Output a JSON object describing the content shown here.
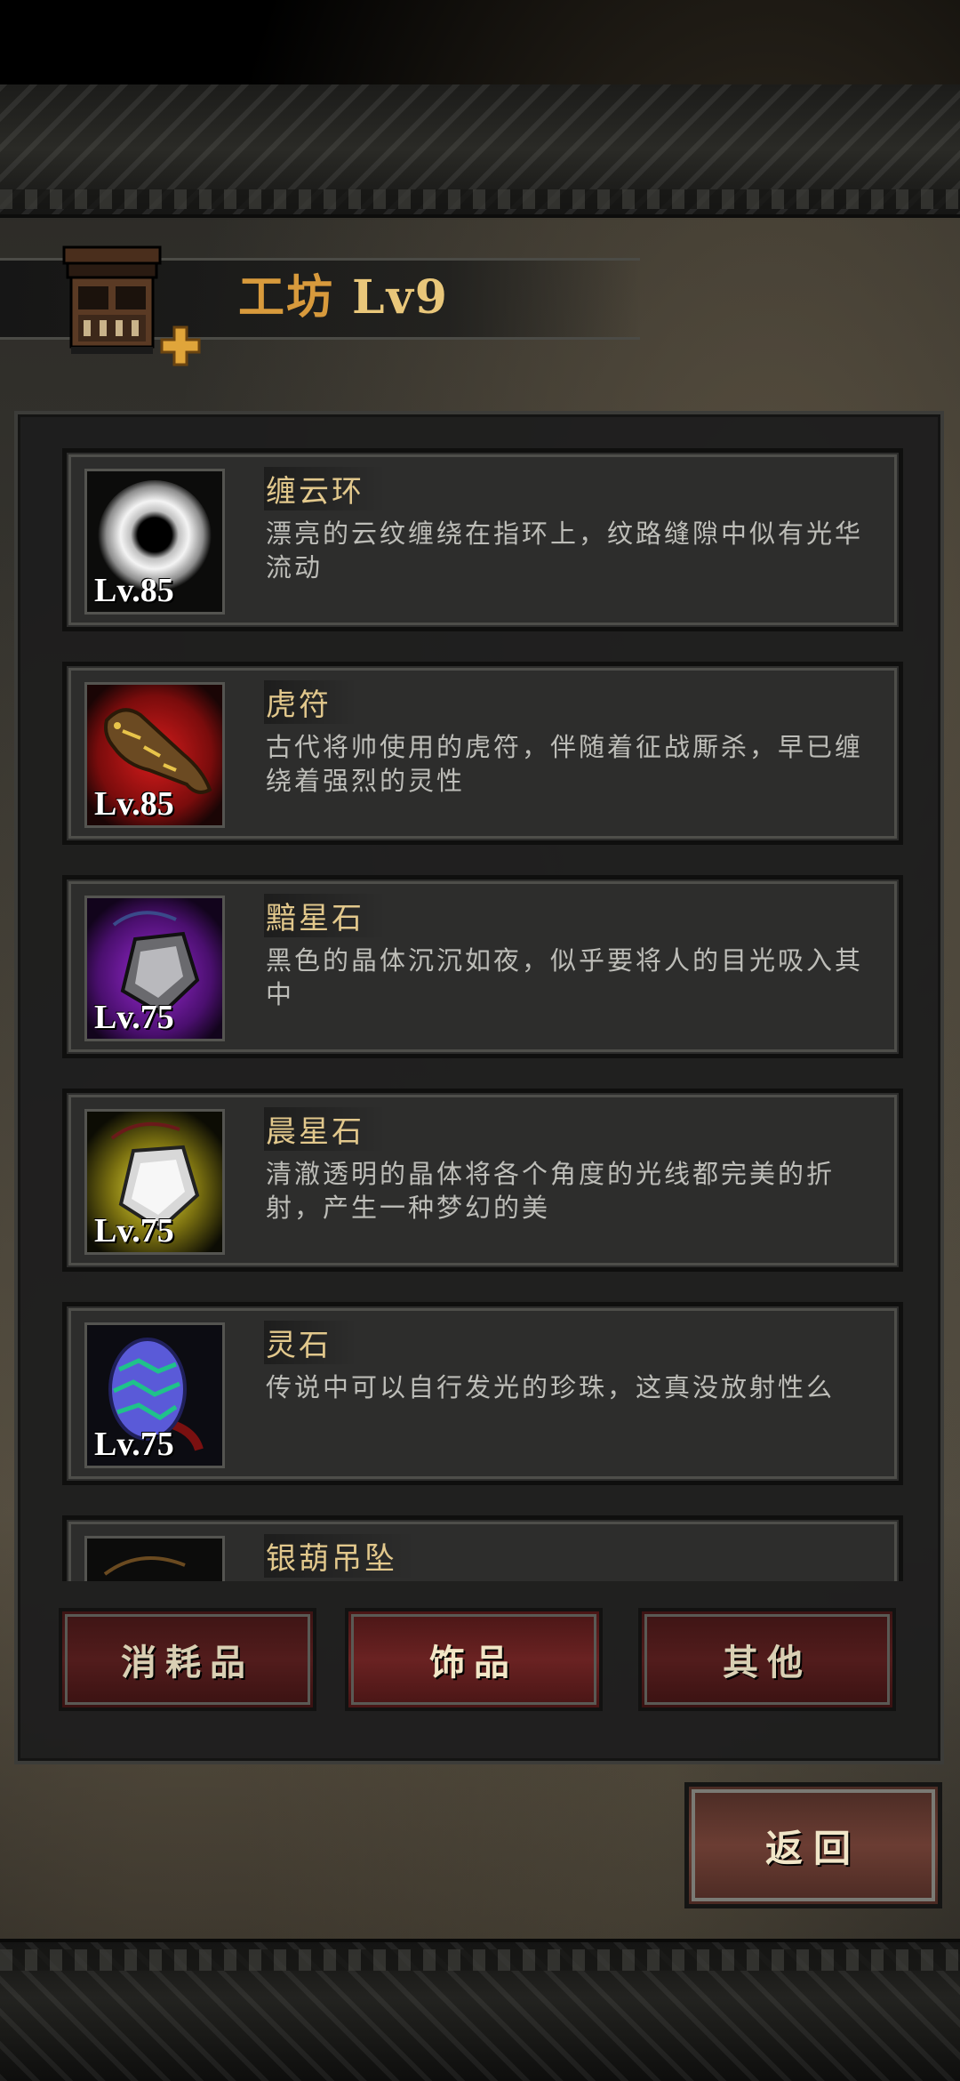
{
  "header": {
    "title": "工坊",
    "level": "Lv9",
    "icon": "workshop-building-icon",
    "badge": "plus-icon"
  },
  "items": [
    {
      "name": "缠云环",
      "level": "Lv.85",
      "desc": "漂亮的云纹缠绕在指环上，纹路缝隙中似有光华流动",
      "icon": "cloud-ring-icon"
    },
    {
      "name": "虎符",
      "level": "Lv.85",
      "desc": "古代将帅使用的虎符，伴随着征战厮杀，早已缠绕着强烈的灵性",
      "icon": "tiger-tally-icon"
    },
    {
      "name": "黯星石",
      "level": "Lv.75",
      "desc": "黑色的晶体沉沉如夜，似乎要将人的目光吸入其中",
      "icon": "dark-star-stone-icon"
    },
    {
      "name": "晨星石",
      "level": "Lv.75",
      "desc": "清澈透明的晶体将各个角度的光线都完美的折射，产生一种梦幻的美",
      "icon": "morning-star-stone-icon"
    },
    {
      "name": "灵石",
      "level": "Lv.75",
      "desc": "传说中可以自行发光的珍珠，这真没放射性么",
      "icon": "spirit-stone-icon"
    },
    {
      "name": "银葫吊坠",
      "level": "",
      "desc": "",
      "icon": "silver-gourd-pendant-icon"
    }
  ],
  "tabs": {
    "consumables": "消耗品",
    "accessories": "饰品",
    "other": "其他",
    "active": "accessories"
  },
  "back_label": "返回",
  "colors": {
    "title": "#d89a3c",
    "item_name": "#e2c88c",
    "tab_red": "#521c1c"
  }
}
